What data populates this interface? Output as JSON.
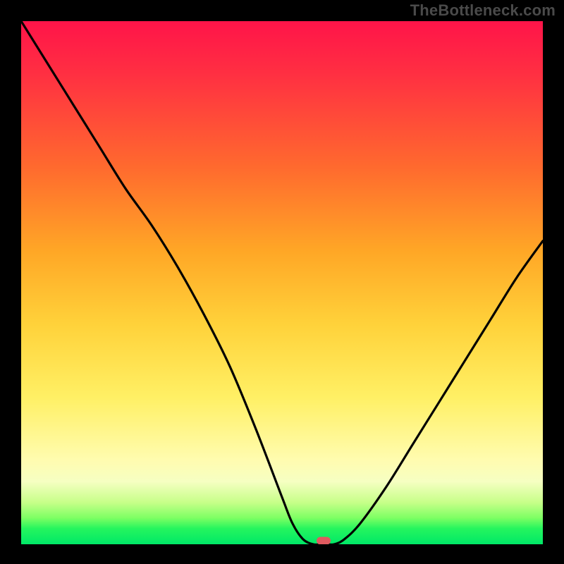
{
  "watermark": "TheBottleneck.com",
  "colors": {
    "page_bg": "#000000",
    "curve_stroke": "#000000",
    "marker_fill": "#e05a5f",
    "watermark_text": "#4a4a4a"
  },
  "chart_data": {
    "type": "line",
    "title": "",
    "xlabel": "",
    "ylabel": "",
    "xlim": [
      0,
      100
    ],
    "ylim": [
      0,
      100
    ],
    "note": "Axes have no visible tick labels; x and y are normalized 0–100. Curve values estimated from gridless plot.",
    "series": [
      {
        "name": "bottleneck-curve",
        "x": [
          0,
          5,
          10,
          15,
          20,
          25,
          30,
          35,
          40,
          45,
          50,
          52,
          54,
          56,
          58,
          60,
          62,
          65,
          70,
          75,
          80,
          85,
          90,
          95,
          100
        ],
        "y": [
          100,
          92,
          84,
          76,
          68,
          61,
          53,
          44,
          34,
          22,
          9,
          4,
          1,
          0,
          0,
          0,
          1,
          4,
          11,
          19,
          27,
          35,
          43,
          51,
          58
        ]
      }
    ],
    "marker": {
      "x": 58,
      "y": 0.7,
      "label": "optimal-point"
    },
    "background_gradient_stops": [
      {
        "pos": 0.0,
        "color": "#ff1449"
      },
      {
        "pos": 0.1,
        "color": "#ff2f42"
      },
      {
        "pos": 0.28,
        "color": "#ff6a2e"
      },
      {
        "pos": 0.44,
        "color": "#ffa726"
      },
      {
        "pos": 0.58,
        "color": "#ffd23a"
      },
      {
        "pos": 0.72,
        "color": "#fff065"
      },
      {
        "pos": 0.84,
        "color": "#fffcb0"
      },
      {
        "pos": 0.88,
        "color": "#f6ffc2"
      },
      {
        "pos": 0.92,
        "color": "#c7ff89"
      },
      {
        "pos": 0.95,
        "color": "#7cff63"
      },
      {
        "pos": 0.97,
        "color": "#25f55e"
      },
      {
        "pos": 1.0,
        "color": "#00e867"
      }
    ]
  }
}
